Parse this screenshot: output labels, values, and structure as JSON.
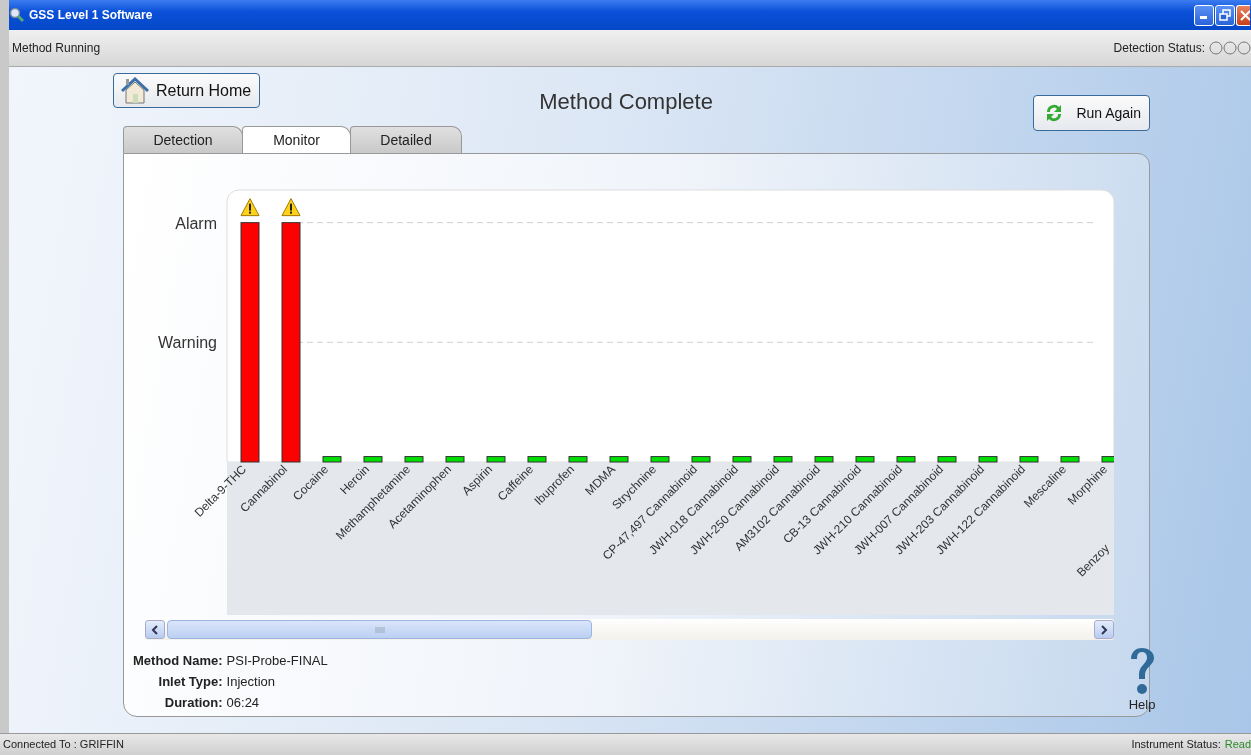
{
  "window": {
    "title": "GSS Level 1 Software"
  },
  "toolbar": {
    "status_text": "Method Running",
    "detection_label": "Detection Status:"
  },
  "header": {
    "return_button": "Return Home",
    "title": "Method Complete",
    "run_again_button": "Run Again"
  },
  "tabs": [
    {
      "label": "Detection",
      "selected": false
    },
    {
      "label": "Monitor",
      "selected": true
    },
    {
      "label": "Detailed",
      "selected": false
    }
  ],
  "chart": {
    "y_labels": [
      "Alarm",
      "Warning"
    ],
    "bars": [
      {
        "label": "Delta-9-THC",
        "level": 0.88,
        "color": "#ff0000",
        "alarm": true
      },
      {
        "label": "Cannabinol",
        "level": 0.88,
        "color": "#ff0000",
        "alarm": true
      },
      {
        "label": "Cocaine",
        "level": 0.02,
        "color": "#00e000",
        "alarm": false
      },
      {
        "label": "Heroin",
        "level": 0.02,
        "color": "#00e000",
        "alarm": false
      },
      {
        "label": "Methamphetamine",
        "level": 0.02,
        "color": "#00e000",
        "alarm": false
      },
      {
        "label": "Acetaminophen",
        "level": 0.02,
        "color": "#00e000",
        "alarm": false
      },
      {
        "label": "Aspirin",
        "level": 0.02,
        "color": "#00e000",
        "alarm": false
      },
      {
        "label": "Caffeine",
        "level": 0.02,
        "color": "#00e000",
        "alarm": false
      },
      {
        "label": "Ibuprofen",
        "level": 0.02,
        "color": "#00e000",
        "alarm": false
      },
      {
        "label": "MDMA",
        "level": 0.02,
        "color": "#00e000",
        "alarm": false
      },
      {
        "label": "Strychnine",
        "level": 0.02,
        "color": "#00e000",
        "alarm": false
      },
      {
        "label": "CP-47,497 Cannabinoid",
        "level": 0.02,
        "color": "#00e000",
        "alarm": false
      },
      {
        "label": "JWH-018 Cannabinoid",
        "level": 0.02,
        "color": "#00e000",
        "alarm": false
      },
      {
        "label": "JWH-250 Cannabinoid",
        "level": 0.02,
        "color": "#00e000",
        "alarm": false
      },
      {
        "label": "AM3102 Cannabinoid",
        "level": 0.02,
        "color": "#00e000",
        "alarm": false
      },
      {
        "label": "CB-13 Cannabinoid",
        "level": 0.02,
        "color": "#00e000",
        "alarm": false
      },
      {
        "label": "JWH-210 Cannabinoid",
        "level": 0.02,
        "color": "#00e000",
        "alarm": false
      },
      {
        "label": "JWH-007 Cannabinoid",
        "level": 0.02,
        "color": "#00e000",
        "alarm": false
      },
      {
        "label": "JWH-203 Cannabinoid",
        "level": 0.02,
        "color": "#00e000",
        "alarm": false
      },
      {
        "label": "JWH-122 Cannabinoid",
        "level": 0.02,
        "color": "#00e000",
        "alarm": false
      },
      {
        "label": "Mescaline",
        "level": 0.02,
        "color": "#00e000",
        "alarm": false
      },
      {
        "label": "Morphine",
        "level": 0.02,
        "color": "#00e000",
        "alarm": false
      },
      {
        "label": "Benzoy"
      }
    ]
  },
  "method_info": [
    {
      "label": "Method Name:",
      "value": "PSI-Probe-FINAL"
    },
    {
      "label": "Inlet Type:",
      "value": "Injection"
    },
    {
      "label": "Duration:",
      "value": "06:24"
    }
  ],
  "help": {
    "label": "Help"
  },
  "status_bar": {
    "connection": "Connected To : GRIFFIN",
    "instrument_label": "Instrument Status:",
    "instrument_value": "Read"
  }
}
